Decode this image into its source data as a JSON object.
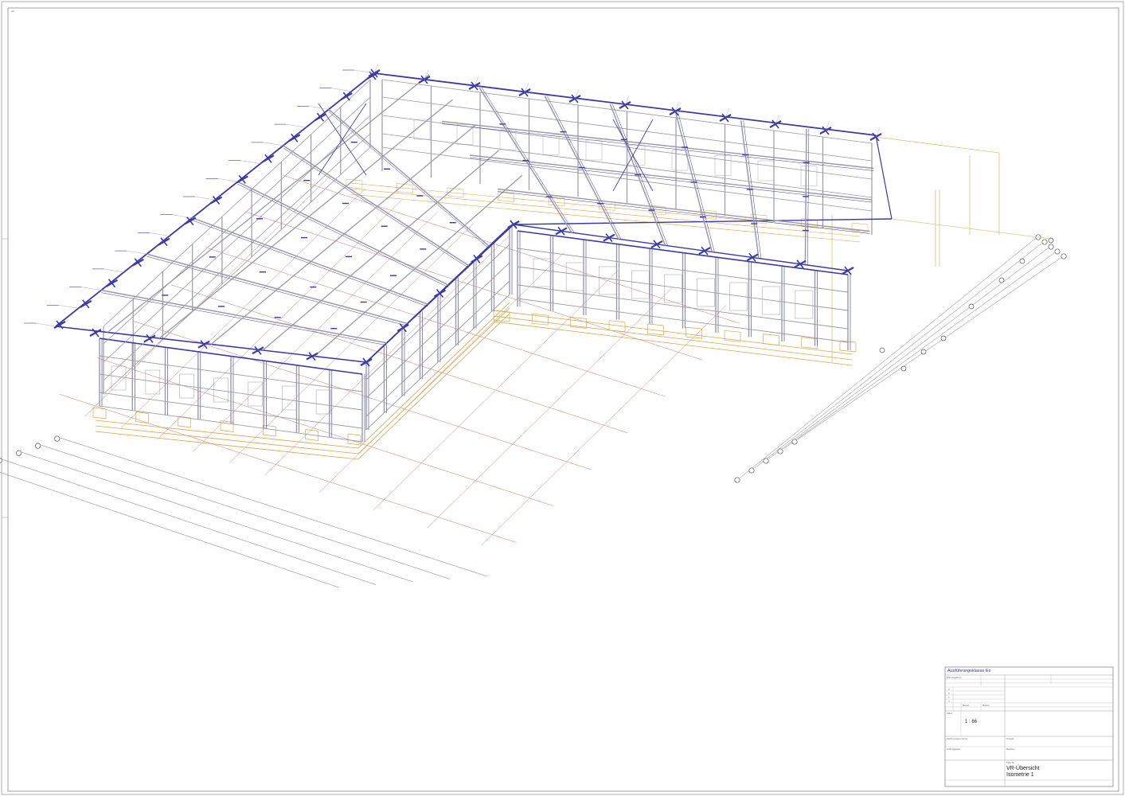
{
  "sheet": {
    "corner_label": "A0"
  },
  "drawing": {
    "type": "isometric steel frame structure",
    "colors": {
      "frame": "#3a3aa8",
      "frame_light": "#9a9aa6",
      "foundation": "#d9a54a",
      "grid": "#c46a5a",
      "dimension": "#555555"
    }
  },
  "title_block": {
    "header": "Ausführungsklasse Ex",
    "scale": "1 : 66",
    "title_line1": "VR-Übersicht",
    "title_line2": "Isometrie 1",
    "row_labels": [
      "a",
      "b",
      "c",
      "d"
    ],
    "tiny_fields": [
      "Planungsbüro",
      "Projekt",
      "Bauherr",
      "Auftraggeber",
      "Zeichnungsnummer",
      "Datum",
      "Name",
      "Index",
      "Plan-Nr"
    ]
  }
}
